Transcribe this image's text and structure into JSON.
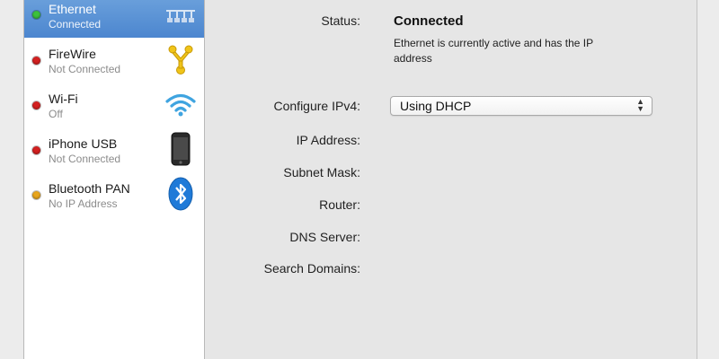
{
  "services": [
    {
      "name": "Ethernet",
      "status": "Connected",
      "status_color": "#3cc13c",
      "selected": true,
      "icon": "ethernet-icon"
    },
    {
      "name": "FireWire",
      "status": "Not Connected",
      "status_color": "#d42020",
      "selected": false,
      "icon": "firewire-icon"
    },
    {
      "name": "Wi-Fi",
      "status": "Off",
      "status_color": "#d42020",
      "selected": false,
      "icon": "wifi-icon"
    },
    {
      "name": "iPhone USB",
      "status": "Not Connected",
      "status_color": "#d42020",
      "selected": false,
      "icon": "iphone-icon"
    },
    {
      "name": "Bluetooth PAN",
      "status": "No IP Address",
      "status_color": "#e8a51c",
      "selected": false,
      "icon": "bluetooth-icon"
    }
  ],
  "detail": {
    "status_label": "Status:",
    "status_value": "Connected",
    "status_description": "Ethernet is currently active and has the IP address",
    "configure_label": "Configure IPv4:",
    "configure_value": "Using DHCP",
    "ip_label": "IP Address:",
    "subnet_label": "Subnet Mask:",
    "router_label": "Router:",
    "dns_label": "DNS Server:",
    "search_label": "Search Domains:"
  },
  "colors": {
    "selection": "#5a92d6",
    "sidebar_bg": "#ffffff",
    "panel_bg": "#e6e6e6"
  }
}
